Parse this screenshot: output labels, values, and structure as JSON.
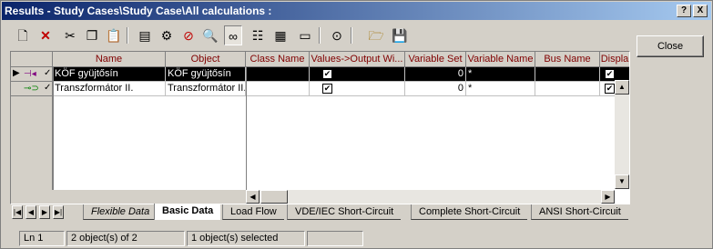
{
  "window": {
    "title": "Results - Study Cases\\Study Case\\All calculations :",
    "help_label": "?",
    "close_x_label": "X"
  },
  "toolbar": {
    "icons": [
      "new-object-icon",
      "delete-icon",
      "cut-icon",
      "copy-icon",
      "paste-icon",
      "edit-icon",
      "filter-icon",
      "stop-icon",
      "find-object-icon",
      "view-icon",
      "sort-icon",
      "level-icon",
      "new-page-icon",
      "binoculars-icon",
      "open-folder-icon",
      "save-icon"
    ]
  },
  "close_button": {
    "label": "Close"
  },
  "table": {
    "columns": [
      "Name",
      "Object",
      "Class Name",
      "Values->Output Wi...",
      "Variable Set",
      "Variable Name",
      "Bus Name",
      "Displa"
    ],
    "rows": [
      {
        "name": "KÖF gyüjtősín",
        "object": "KÖF gyüjtősín",
        "class_name": "",
        "output_window": "✔",
        "variable_set": "0",
        "variable_name": "*",
        "bus_name": "",
        "display": "✔",
        "selected": true
      },
      {
        "name": "Transzformátor II.",
        "object": "Transzformátor II.",
        "class_name": "",
        "output_window": "✔",
        "variable_set": "0",
        "variable_name": "*",
        "bus_name": "",
        "display": "✔",
        "selected": false
      }
    ]
  },
  "tabs": [
    "Flexible Data",
    "Basic Data",
    "Load Flow",
    "VDE/IEC Short-Circuit",
    "Complete Short-Circuit",
    "ANSI Short-Circuit"
  ],
  "active_tab": "Basic Data",
  "status": {
    "line": "Ln 1",
    "objects": "2 object(s) of 2",
    "selected": "1 object(s) selected",
    "extra": ""
  }
}
